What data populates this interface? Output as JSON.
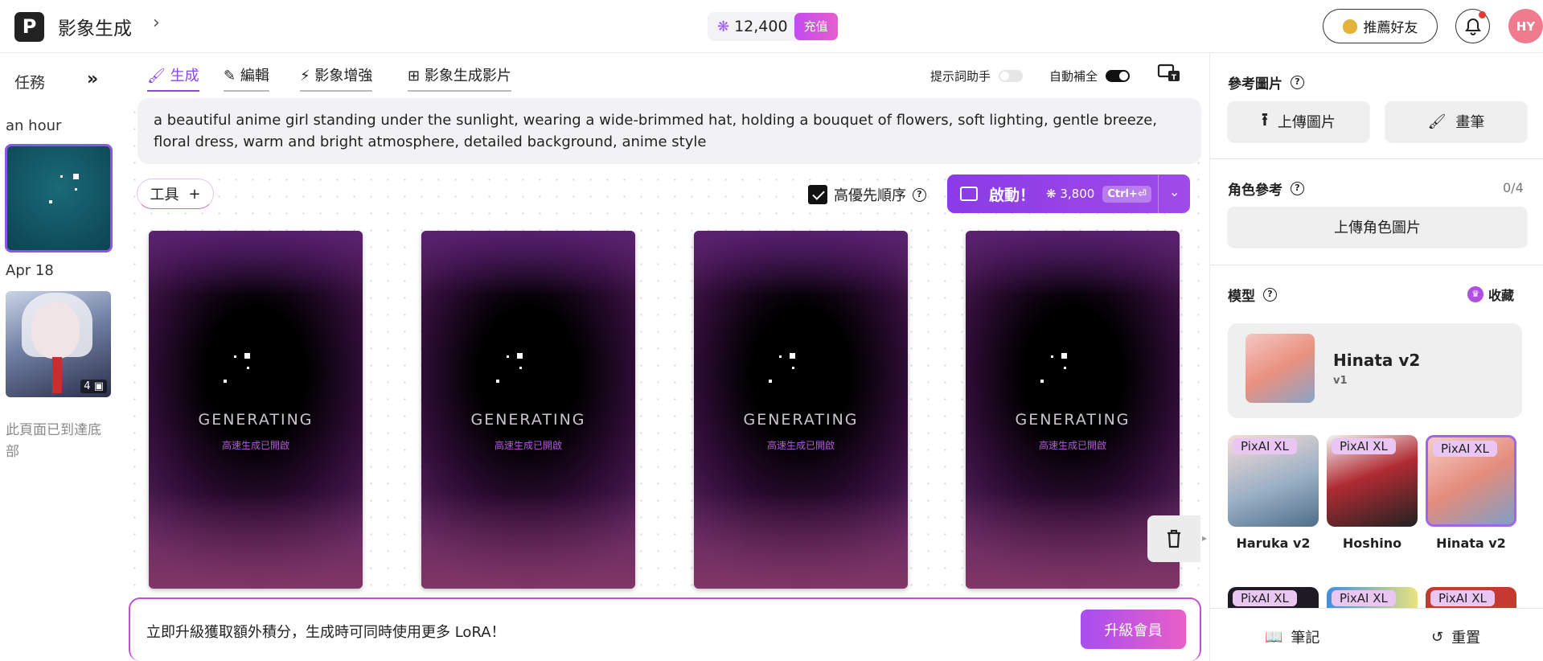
{
  "topbar": {
    "logo_letter": "P",
    "app_title": "影象生成",
    "credits": "12,400",
    "topup_label": "充值",
    "invite_label": "推薦好友",
    "avatar_initials": "HY"
  },
  "history": {
    "tasks_label": "任務",
    "group1_label": "an hour",
    "group2_label": "Apr 18",
    "thumb2_count": "4",
    "bottom_note": "此頁面已到達底部"
  },
  "tabs": [
    {
      "label": "生成",
      "icon": "brush-icon",
      "active": true
    },
    {
      "label": "編輯",
      "icon": "pencil-icon",
      "active": false
    },
    {
      "label": "影象增強",
      "icon": "magic-wand-icon",
      "active": false
    },
    {
      "label": "影象生成影片",
      "icon": "video-add-icon",
      "active": false
    }
  ],
  "toggles": {
    "hint_label": "提示詞助手",
    "hint_on": false,
    "autocomplete_label": "自動補全",
    "autocomplete_on": true
  },
  "prompt_text": "a beautiful anime girl standing under the sunlight, wearing a wide-brimmed hat, holding a bouquet of flowers, soft lighting, gentle breeze, floral dress, warm and bright atmosphere, detailed background, anime style",
  "tools_label": "工具",
  "priority": {
    "label": "高優先順序",
    "checked": true
  },
  "launch": {
    "label": "啟動！",
    "cost": "3,800",
    "shortcut": "Ctrl+⏎"
  },
  "cards": [
    {
      "status": "GENERATING",
      "sub": "高速生成已開啟"
    },
    {
      "status": "GENERATING",
      "sub": "高速生成已開啟"
    },
    {
      "status": "GENERATING",
      "sub": "高速生成已開啟"
    },
    {
      "status": "GENERATING",
      "sub": "高速生成已開啟"
    }
  ],
  "upgrade": {
    "text": "立即升級獲取額外積分，生成時可同時使用更多 LoRA！",
    "button": "升級會員"
  },
  "right": {
    "ref_title": "參考圖片",
    "upload_label": "上傳圖片",
    "brush_label": "畫筆",
    "char_title": "角色參考",
    "char_count": "0/4",
    "char_upload": "上傳角色圖片",
    "model_title": "模型",
    "fav_label": "收藏",
    "current_model": {
      "name": "Hinata v2",
      "version": "v1"
    },
    "models": [
      {
        "tag": "PixAI XL",
        "name": "Haruka v2",
        "selected": false
      },
      {
        "tag": "PixAI XL",
        "name": "Hoshino",
        "selected": false
      },
      {
        "tag": "PixAI XL",
        "name": "Hinata v2",
        "selected": true
      }
    ],
    "models_row2": [
      {
        "tag": "PixAI XL"
      },
      {
        "tag": "PixAI XL"
      },
      {
        "tag": "PixAI XL"
      }
    ],
    "notes_label": "筆記",
    "reset_label": "重置"
  },
  "colors": {
    "accent": "#8b46e8",
    "pink": "#e65fc9"
  }
}
